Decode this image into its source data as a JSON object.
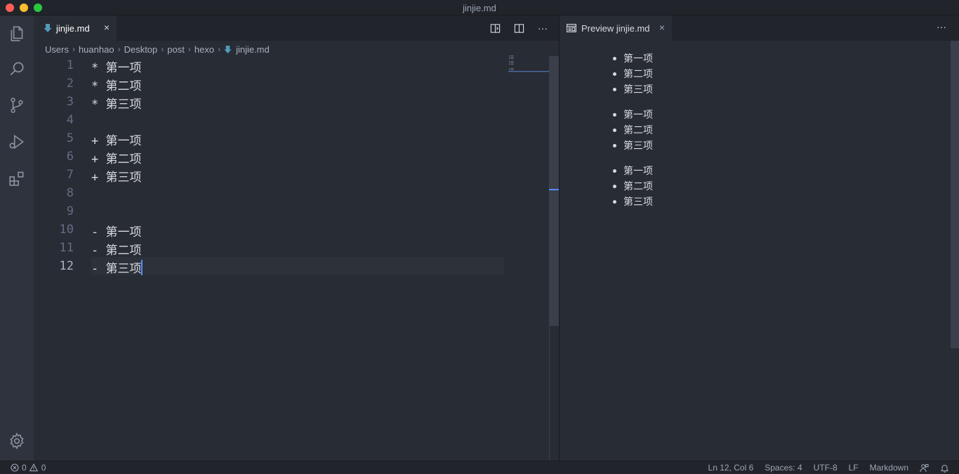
{
  "window": {
    "title": "jinjie.md"
  },
  "editor": {
    "tab_label": "jinjie.md",
    "tab_close": "×",
    "more_actions": "···",
    "breadcrumb": [
      "Users",
      "huanhao",
      "Desktop",
      "post",
      "hexo",
      "jinjie.md"
    ],
    "lines": [
      {
        "num": "1",
        "text": "* 第一项"
      },
      {
        "num": "2",
        "text": "* 第二项"
      },
      {
        "num": "3",
        "text": "* 第三项"
      },
      {
        "num": "4",
        "text": ""
      },
      {
        "num": "5",
        "text": "+ 第一项"
      },
      {
        "num": "6",
        "text": "+ 第二项"
      },
      {
        "num": "7",
        "text": "+ 第三项"
      },
      {
        "num": "8",
        "text": ""
      },
      {
        "num": "9",
        "text": ""
      },
      {
        "num": "10",
        "text": "- 第一项"
      },
      {
        "num": "11",
        "text": "- 第二项"
      },
      {
        "num": "12",
        "text": "- 第三项"
      }
    ],
    "current_line": 12
  },
  "preview": {
    "tab_label": "Preview jinjie.md",
    "tab_close": "×",
    "more_actions": "···",
    "lists": [
      [
        "第一项",
        "第二项",
        "第三项"
      ],
      [
        "第一项",
        "第二项",
        "第三项"
      ],
      [
        "第一项",
        "第二项",
        "第三项"
      ]
    ]
  },
  "status": {
    "errors": "0",
    "warnings": "0",
    "position": "Ln 12, Col 6",
    "spaces": "Spaces: 4",
    "encoding": "UTF-8",
    "eol": "LF",
    "language": "Markdown"
  },
  "colors": {
    "accent": "#528bff",
    "markdown_icon": "#519aba"
  }
}
